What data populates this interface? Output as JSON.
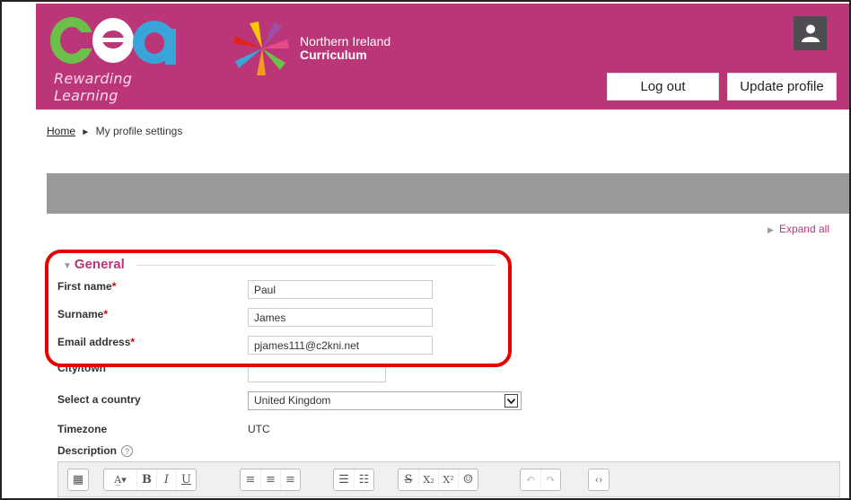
{
  "header": {
    "cea_logo_text": "cea",
    "cea_tagline": "Rewarding Learning",
    "ni_line1": "Northern Ireland",
    "ni_line2": "Curriculum",
    "logout_label": "Log out",
    "update_profile_label": "Update profile",
    "brand_color": "#bb3679"
  },
  "breadcrumb": {
    "home": "Home",
    "separator": "►",
    "current": "My profile settings"
  },
  "expand_all": "Expand all",
  "general": {
    "legend": "General",
    "first_name_label": "First name",
    "first_name_value": "Paul",
    "surname_label": "Surname",
    "surname_value": "James",
    "email_label": "Email address",
    "email_value": "pjames111@c2kni.net",
    "city_label": "City/town",
    "city_value": "",
    "country_label": "Select a country",
    "country_value": "United Kingdom",
    "timezone_label": "Timezone",
    "timezone_value": "UTC",
    "description_label": "Description",
    "required_mark": "*"
  },
  "toolbar": {
    "icons": [
      "toggle-toolbar-icon",
      "font-size-icon",
      "bold-icon",
      "italic-icon",
      "underline-icon",
      "align-left-icon",
      "align-center-icon",
      "align-right-icon",
      "unordered-list-icon",
      "ordered-list-icon",
      "strikethrough-icon",
      "subscript-icon",
      "superscript-icon",
      "emoticon-icon",
      "undo-icon",
      "redo-icon",
      "html-source-icon"
    ]
  }
}
